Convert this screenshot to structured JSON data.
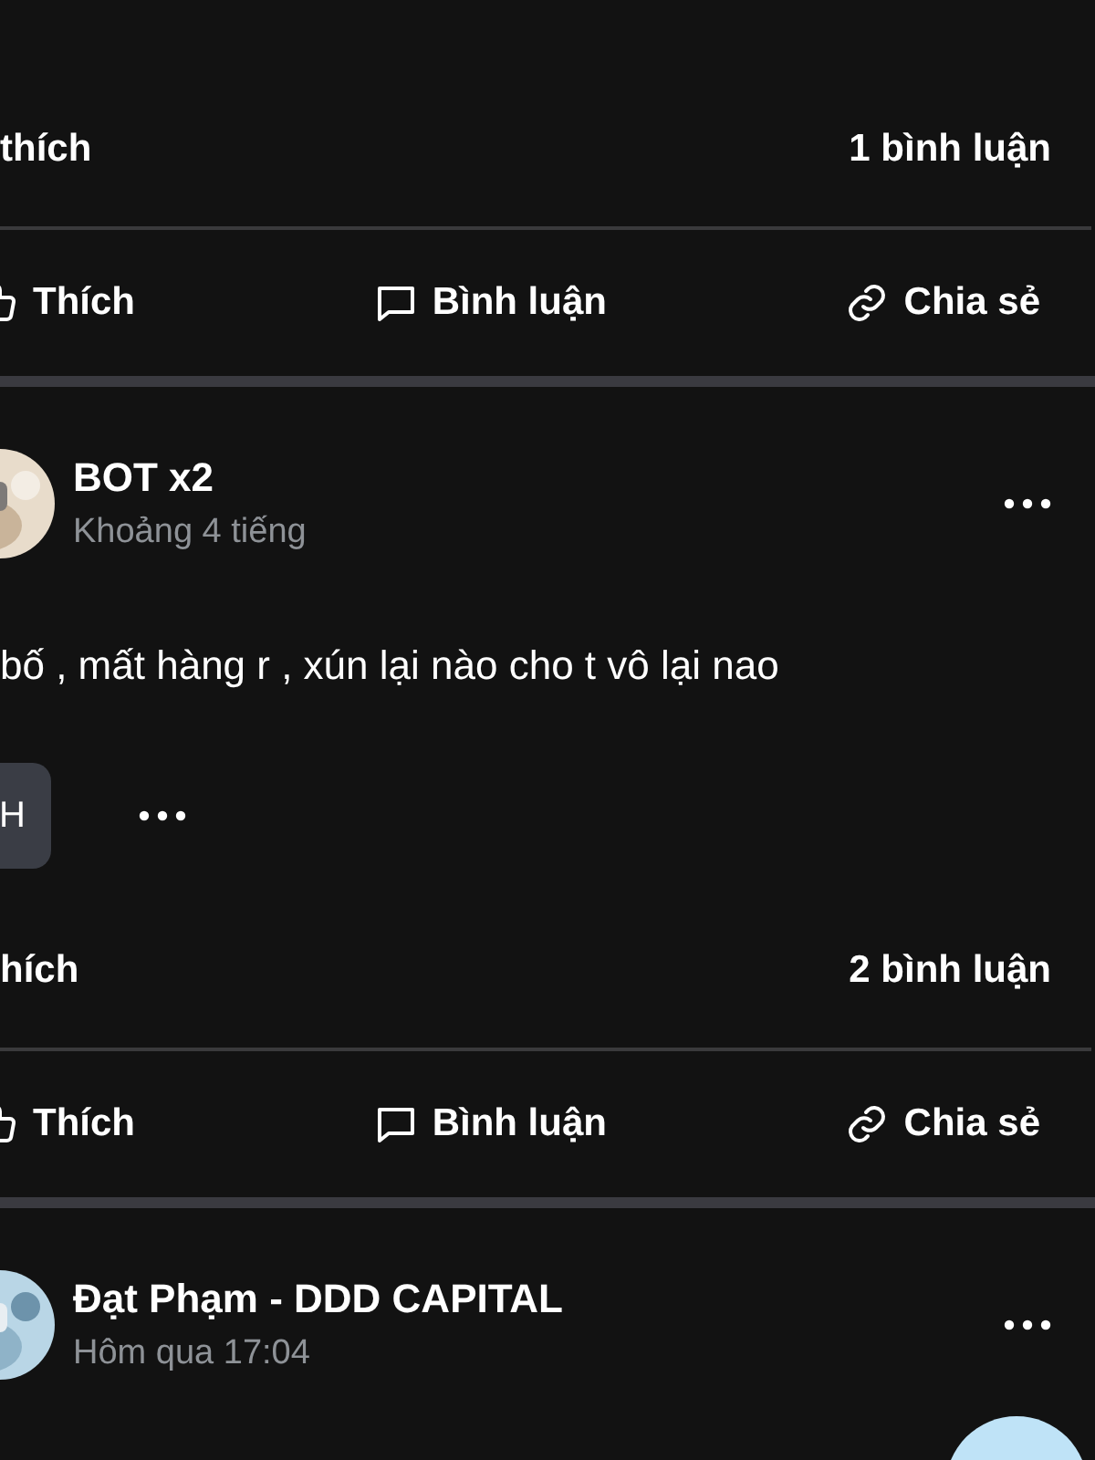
{
  "posts": [
    {
      "stats": {
        "likes": "thích",
        "comments": "1 bình luận"
      },
      "actions": [
        {
          "kind": "like",
          "label": "Thích"
        },
        {
          "kind": "comment",
          "label": "Bình luận"
        },
        {
          "kind": "share",
          "label": "Chia sẻ"
        }
      ]
    },
    {
      "author": "BOT x2",
      "time": "Khoảng 4 tiếng",
      "text": "bố , mất hàng r , xún lại nào cho t vô lại nao",
      "chip": "H",
      "stats": {
        "likes": "hích",
        "comments": "2 bình luận"
      },
      "actions": [
        {
          "kind": "like",
          "label": "Thích"
        },
        {
          "kind": "comment",
          "label": "Bình luận"
        },
        {
          "kind": "share",
          "label": "Chia sẻ"
        }
      ]
    },
    {
      "author": "Đạt Phạm - DDD CAPITAL",
      "time": "Hôm qua 17:04"
    }
  ]
}
